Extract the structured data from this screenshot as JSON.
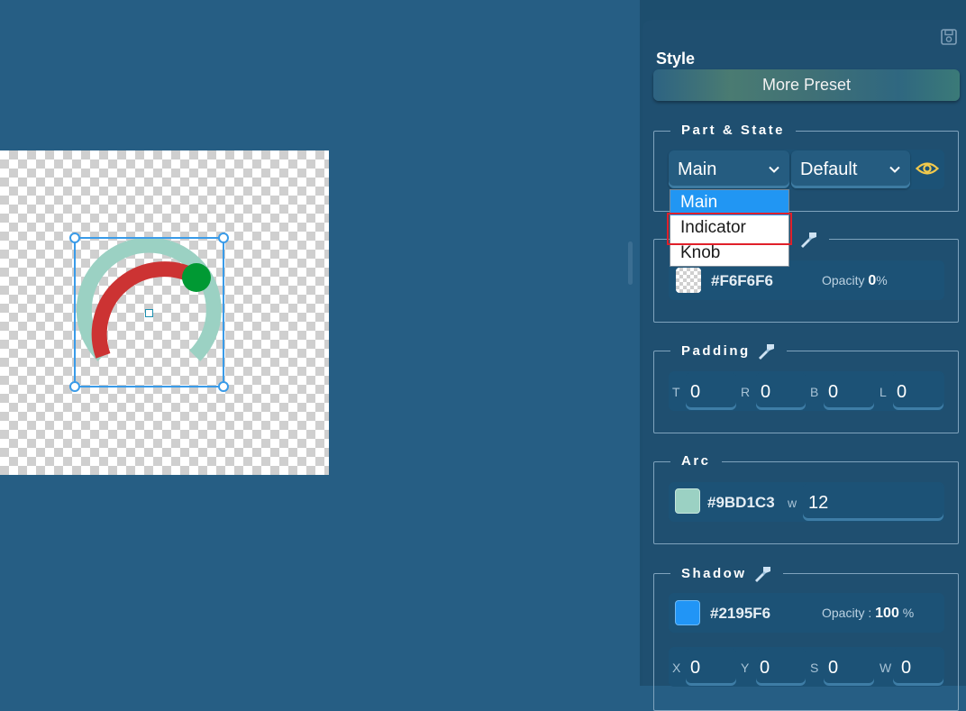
{
  "canvas": {
    "arc": {
      "background_color": "#9BD1C3",
      "indicator_color": "#CC3333",
      "knob_color": "#009933",
      "selection_color": "#3A9BE8"
    }
  },
  "panel": {
    "title": "Style",
    "more_preset_label": "More Preset",
    "part_state": {
      "legend": "Part & State",
      "part_value": "Main",
      "state_value": "Default",
      "part_options": [
        "Main",
        "Indicator",
        "Knob"
      ],
      "highlighted_option": "Indicator"
    },
    "background": {
      "color": "#F6F6F6",
      "opacity_label": "Opacity",
      "opacity_value": "0",
      "opacity_unit": "%"
    },
    "padding": {
      "legend": "Padding",
      "fields": [
        {
          "label": "T",
          "value": "0"
        },
        {
          "label": "R",
          "value": "0"
        },
        {
          "label": "B",
          "value": "0"
        },
        {
          "label": "L",
          "value": "0"
        }
      ]
    },
    "arc": {
      "legend": "Arc",
      "color": "#9BD1C3",
      "width_label": "w",
      "width_value": "12"
    },
    "shadow": {
      "legend": "Shadow",
      "color": "#2195F6",
      "opacity_label": "Opacity :",
      "opacity_value": "100",
      "opacity_unit": "%",
      "fields": [
        {
          "label": "X",
          "value": "0"
        },
        {
          "label": "Y",
          "value": "0"
        },
        {
          "label": "S",
          "value": "0"
        },
        {
          "label": "W",
          "value": "0"
        }
      ]
    }
  }
}
